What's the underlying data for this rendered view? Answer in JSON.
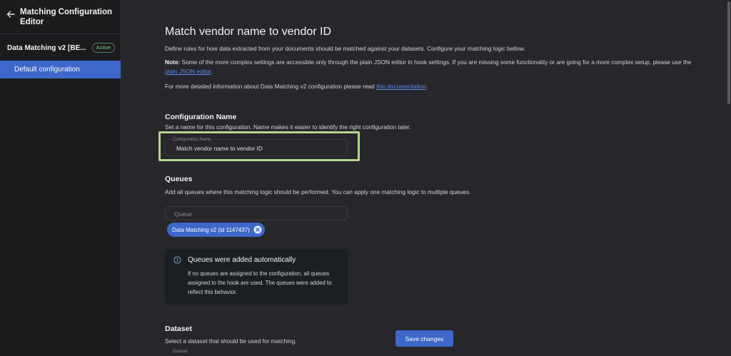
{
  "sidebar": {
    "title": "Matching Configuration Editor",
    "section_label": "Data Matching v2 [BE...",
    "status_badge": "Active",
    "items": [
      {
        "label": "Default configuration",
        "selected": true
      }
    ]
  },
  "main": {
    "title": "Match vendor name to vendor ID",
    "intro": "Define rules for how data extracted from your documents should be matched against your datasets. Configure your matching logic bellow.",
    "note_label": "Note:",
    "note_text": " Some of the more complex settings are accessible only through the plain JSON editor in hook settings. If you are missing some functionality or are going for a more complex setup, please use the ",
    "note_link": "plain JSON editor",
    "note_end": ".",
    "docs_text": "For more detailed information about Data Matching v2 configuration please read ",
    "docs_link": "this documentation",
    "docs_end": ".",
    "config_name": {
      "heading": "Configuration Name",
      "description": "Set a name for this configuration. Name makes it easier to identify the right configuration later.",
      "field_label": "Configuration Name",
      "field_value": "Match vendor name to vendor ID"
    },
    "queues": {
      "heading": "Queues",
      "description": "Add all queues where this matching logic should be performed. You can apply one matching logic to multiple queues.",
      "input_placeholder": "Queue",
      "chips": [
        "Data Matching v2 (id 1147437)"
      ]
    },
    "info": {
      "title": "Queues were added automatically",
      "body": "If no queues are assigned to the configuration, all queues assigned to the hook are used. The queues were added to reflect this behavior."
    },
    "dataset": {
      "heading": "Dataset",
      "description": "Select a dataset that should be used for matching.",
      "field_label": "Dataset"
    },
    "save_label": "Save changes"
  },
  "colors": {
    "accent": "#3d68c9",
    "highlight_border": "#b5d68c",
    "active_badge": "#7bc98a",
    "link": "#5b8def"
  },
  "icons": {
    "back": "arrow-left-icon",
    "chip_remove": "close-circle-icon",
    "info": "info-circle-icon"
  }
}
